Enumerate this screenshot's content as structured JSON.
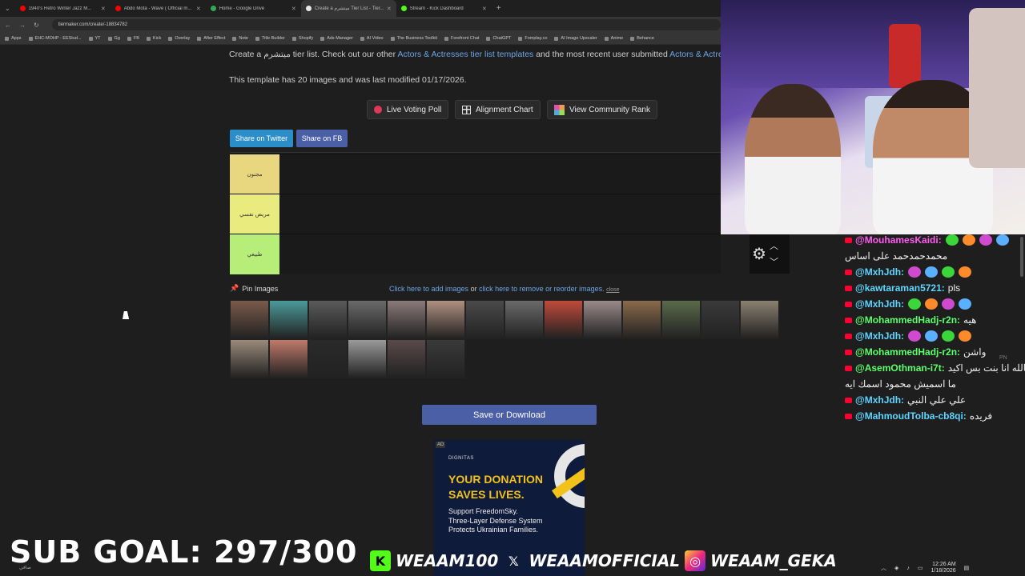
{
  "tabs": [
    {
      "title": "1940's Retro Winter Jazz M...",
      "color": "#ff0000"
    },
    {
      "title": "Abdo Mota - Wave ( Official m...",
      "color": "#ff0000"
    },
    {
      "title": "Home - Google Drive",
      "color": "#34a853"
    },
    {
      "title": "Create a ميتشرم Tier List - Tier...",
      "color": "#e8e8e8",
      "active": true
    },
    {
      "title": "Stream - Kick Dashboard",
      "color": "#53fc18"
    }
  ],
  "url": "tiermaker.com/create/-18834782",
  "bookmarks": [
    "Apps",
    "EHC-MOHP - EEStud...",
    "YT",
    "Gg",
    "FB",
    "Kick",
    "Overlay",
    "After Effect",
    "Note",
    "Title Builder",
    "Shopify",
    "Ads Manager",
    "AI Video",
    "The Business Toolkit",
    "Forefront Chat",
    "ChatGPT",
    "Fomplay.co",
    "AI Image Upscaler",
    "Anime",
    "Behance"
  ],
  "intro": {
    "prefix": "Create a ميتشرم tier list. Check out our other ",
    "link1": "Actors & Actresses tier list templates",
    "middle": " and the most recent user submitted ",
    "link2": "Actors & Actresses"
  },
  "template_info": "This template has 20 images and was last modified 01/17/2026.",
  "buttons": {
    "live_poll": "Live Voting Poll",
    "alignment": "Alignment Chart",
    "community": "View Community Rank",
    "share_twitter": "Share on Twitter",
    "share_fb": "Share on FB",
    "save": "Save or Download"
  },
  "tiers": [
    {
      "label": "مجنون",
      "color": "#e9d77f"
    },
    {
      "label": "مريض نفسي",
      "color": "#e9eb7e"
    },
    {
      "label": "طبيعي",
      "color": "#b7ee7a"
    }
  ],
  "pin_images": "Pin Images",
  "image_links": {
    "add": "Click here to add images",
    "or": " or ",
    "remove": "click here to remove or reorder images.",
    "close": "close"
  },
  "thumb_colors": [
    "#7a5a4a",
    "#4a9a9a",
    "#5a5a5a",
    "#6a6a6a",
    "#8a7a7a",
    "#b09080",
    "#4a4a4a",
    "#6a6a6a",
    "#c04a3a",
    "#9a8a8a",
    "#8a6a4a",
    "#5a6a4a",
    "#3a3a3a",
    "#8a8070",
    "#9a8a7a",
    "#c07a6a",
    "#2a2a2a",
    "#9a9a9a",
    "#5a4a4a",
    "#3a3a3a"
  ],
  "ad": {
    "badge": "AD",
    "brand": "DIGNITAS",
    "headline1": "YOUR DONATION",
    "headline2": "SAVES LIVES.",
    "body1": "Support FreedomSky.",
    "body2": "Three-Layer Defense System",
    "body3": "Protects Ukrainian Families."
  },
  "chat": [
    {
      "user": "@MouhamesKaidi:",
      "text": "",
      "cls": "p"
    },
    {
      "user": "",
      "text": "محمدحمدحمد على اساس",
      "cls": ""
    },
    {
      "user": "@MxhJdh:",
      "text": "",
      "cls": ""
    },
    {
      "user": "@kawtaraman5721:",
      "text": "pls",
      "cls": ""
    },
    {
      "user": "@MxhJdh:",
      "text": "",
      "cls": ""
    },
    {
      "user": "@MohammedHadj-r2n:",
      "text": "هيه",
      "cls": "g"
    },
    {
      "user": "@MxhJdh:",
      "text": "",
      "cls": ""
    },
    {
      "user": "@MohammedHadj-r2n:",
      "text": "واشن",
      "cls": "g"
    },
    {
      "user": "@AsemOthman-i7t:",
      "text": "سم بالله انا بنت بس اكيد",
      "cls": "g"
    },
    {
      "user": "",
      "text": "ما اسميش محمود اسمك ايه",
      "cls": ""
    },
    {
      "user": "@MxhJdh:",
      "text": "علي علي النبي",
      "cls": ""
    },
    {
      "user": "@MahmoudTolba-cb8qi:",
      "text": "فريده",
      "cls": ""
    }
  ],
  "chat_pn": "PN",
  "sub_goal": "SUB GOAL: 297/300",
  "socials": {
    "kick": "WEAAM100",
    "x": "WEAAMOFFICIAL",
    "ig": "WEAAM_GEKA"
  },
  "taskbar": {
    "time": "12:26 AM",
    "date": "1/18/2026"
  },
  "weather": "صافي"
}
